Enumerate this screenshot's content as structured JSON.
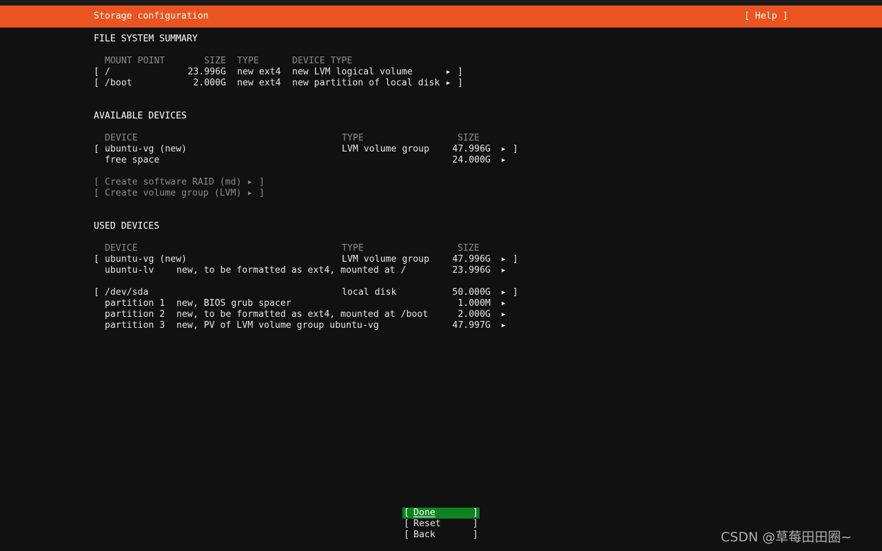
{
  "header": {
    "title": "Storage configuration",
    "help_label": "[ Help ]"
  },
  "fs_summary": {
    "heading": "FILE SYSTEM SUMMARY",
    "columns": [
      "MOUNT POINT",
      "SIZE",
      "TYPE",
      "DEVICE TYPE"
    ],
    "rows": [
      {
        "mount": "/",
        "size": "23.996G",
        "type": "new ext4",
        "device_type": "new LVM logical volume"
      },
      {
        "mount": "/boot",
        "size": "2.000G",
        "type": "new ext4",
        "device_type": "new partition of local disk"
      }
    ]
  },
  "available": {
    "heading": "AVAILABLE DEVICES",
    "columns": [
      "DEVICE",
      "TYPE",
      "SIZE"
    ],
    "rows": [
      {
        "device": "ubuntu-vg (new)",
        "type": "LVM volume group",
        "size": "47.996G"
      },
      {
        "device": "free space",
        "type": "",
        "size": "24.000G"
      }
    ],
    "actions": [
      "Create software RAID (md)",
      "Create volume group (LVM)"
    ]
  },
  "used": {
    "heading": "USED DEVICES",
    "columns": [
      "DEVICE",
      "TYPE",
      "SIZE"
    ],
    "groups": [
      {
        "device": "ubuntu-vg (new)",
        "type": "LVM volume group",
        "size": "47.996G",
        "children": [
          {
            "name": "ubuntu-lv",
            "desc": "new, to be formatted as ext4, mounted at /",
            "size": "23.996G"
          }
        ]
      },
      {
        "device": "/dev/sda",
        "type": "local disk",
        "size": "50.000G",
        "children": [
          {
            "name": "partition 1",
            "desc": "new, BIOS grub spacer",
            "size": "1.000M"
          },
          {
            "name": "partition 2",
            "desc": "new, to be formatted as ext4, mounted at /boot",
            "size": "2.000G"
          },
          {
            "name": "partition 3",
            "desc": "new, PV of LVM volume group ubuntu-vg",
            "size": "47.997G"
          }
        ]
      }
    ]
  },
  "buttons": {
    "done": "Done",
    "reset": "Reset",
    "back": "Back"
  },
  "symbols": {
    "open_bracket": "[",
    "close_bracket": "]",
    "arrow": "▶"
  },
  "watermark": "CSDN @草莓田田圈~",
  "colors": {
    "accent": "#e95420",
    "focus": "#0e8420",
    "background": "#111111"
  }
}
